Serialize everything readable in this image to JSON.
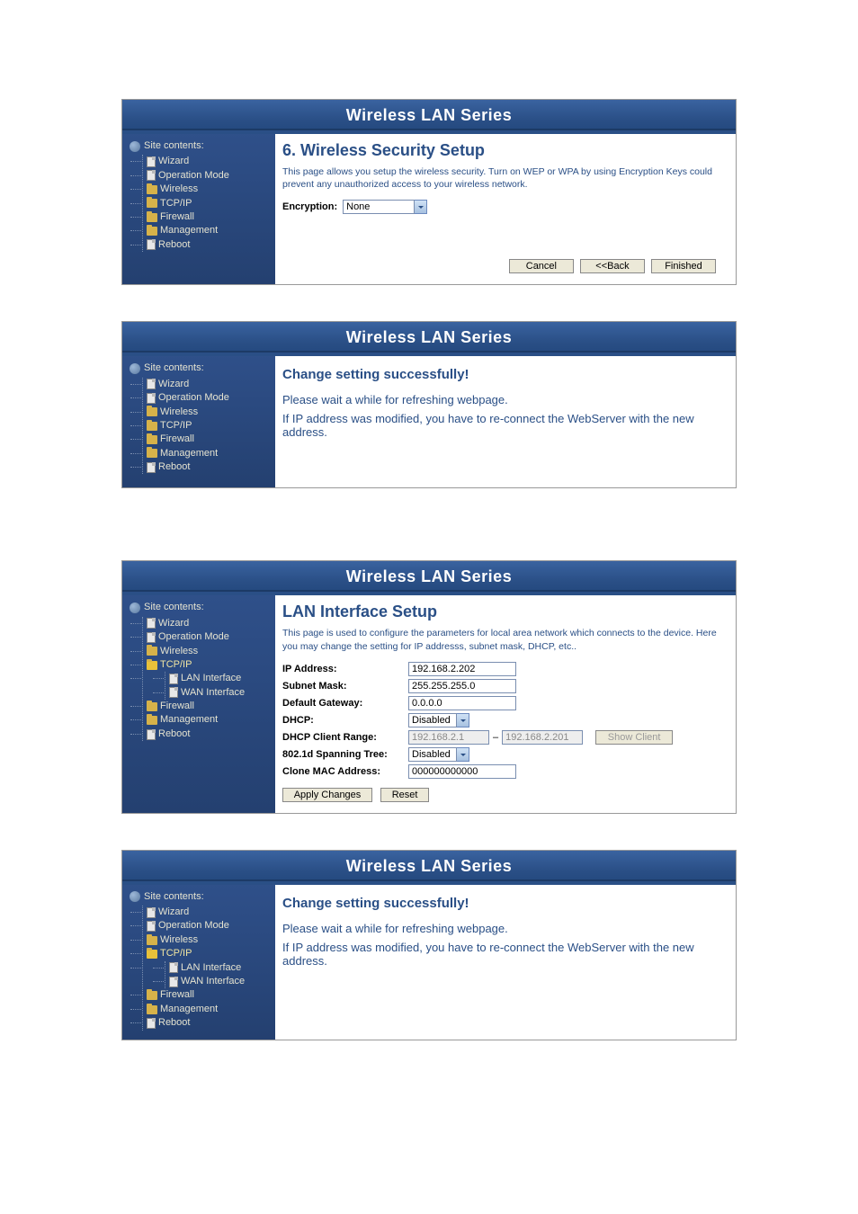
{
  "headerTitle": "Wireless LAN Series",
  "sidebar": {
    "title": "Site contents:",
    "items": [
      {
        "label": "Wizard",
        "icon": "page"
      },
      {
        "label": "Operation Mode",
        "icon": "page"
      },
      {
        "label": "Wireless",
        "icon": "folder"
      },
      {
        "label": "TCP/IP",
        "icon": "folder"
      },
      {
        "label": "Firewall",
        "icon": "folder"
      },
      {
        "label": "Management",
        "icon": "folder"
      },
      {
        "label": "Reboot",
        "icon": "page"
      }
    ],
    "tcpipOpenItems": [
      {
        "label": "LAN Interface",
        "icon": "page"
      },
      {
        "label": "WAN Interface",
        "icon": "page"
      }
    ]
  },
  "panel1": {
    "title": "6. Wireless Security Setup",
    "desc": "This page allows you setup the wireless security. Turn on WEP or WPA by using Encryption Keys could prevent any unauthorized access to your wireless network.",
    "encryptionLabel": "Encryption:",
    "encryptionValue": "None",
    "buttons": {
      "cancel": "Cancel",
      "back": "<<Back",
      "finished": "Finished"
    }
  },
  "panel2": {
    "msgTitle": "Change setting successfully!",
    "msgWait": "Please wait a while for refreshing webpage.",
    "msgIp": "If IP address was modified, you have to re-connect the WebServer with the new address."
  },
  "panel3": {
    "title": "LAN Interface Setup",
    "desc": "This page is used to configure the parameters for local area network which connects to the device. Here you may change the setting for IP addresss, subnet mask, DHCP, etc..",
    "labels": {
      "ip": "IP Address:",
      "mask": "Subnet Mask:",
      "gw": "Default Gateway:",
      "dhcp": "DHCP:",
      "range": "DHCP Client Range:",
      "stp": "802.1d Spanning Tree:",
      "mac": "Clone MAC Address:"
    },
    "values": {
      "ip": "192.168.2.202",
      "mask": "255.255.255.0",
      "gw": "0.0.0.0",
      "dhcp": "Disabled",
      "rangeStart": "192.168.2.1",
      "rangeEnd": "192.168.2.201",
      "stp": "Disabled",
      "mac": "000000000000"
    },
    "buttons": {
      "show": "Show Client",
      "apply": "Apply Changes",
      "reset": "Reset"
    }
  }
}
